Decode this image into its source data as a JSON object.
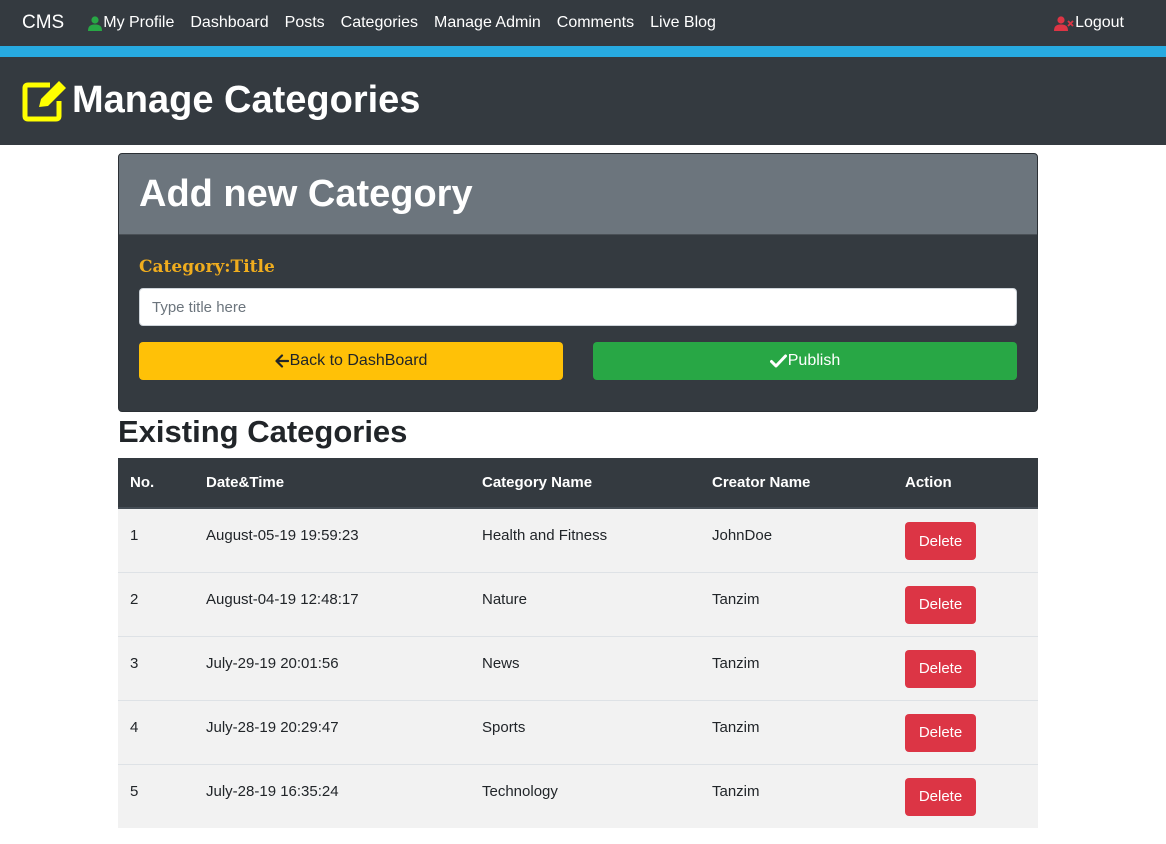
{
  "navbar": {
    "brand": "CMS",
    "links": [
      {
        "label": "My Profile",
        "icon": "user-icon"
      },
      {
        "label": "Dashboard"
      },
      {
        "label": "Posts"
      },
      {
        "label": "Categories"
      },
      {
        "label": "Manage Admin"
      },
      {
        "label": "Comments"
      },
      {
        "label": "Live Blog"
      }
    ],
    "logout": {
      "label": "Logout",
      "icon": "user-times-icon"
    }
  },
  "header": {
    "title": "Manage Categories",
    "icon": "edit-icon"
  },
  "form": {
    "heading": "Add new Category",
    "label": "Category:Title",
    "input_value": "",
    "input_placeholder": "Type title here",
    "back_button": {
      "label": "Back to DashBoard",
      "icon": "arrow-left-icon"
    },
    "publish_button": {
      "label": "Publish",
      "icon": "check-icon"
    }
  },
  "categories": {
    "heading": "Existing Categories",
    "columns": [
      "No.",
      "Date&Time",
      "Category Name",
      "Creator Name",
      "Action"
    ],
    "rows": [
      {
        "no": "1",
        "datetime": "August-05-19 19:59:23",
        "name": "Health and Fitness",
        "creator": "JohnDoe",
        "action": "Delete"
      },
      {
        "no": "2",
        "datetime": "August-04-19 12:48:17",
        "name": "Nature",
        "creator": "Tanzim",
        "action": "Delete"
      },
      {
        "no": "3",
        "datetime": "July-29-19 20:01:56",
        "name": "News",
        "creator": "Tanzim",
        "action": "Delete"
      },
      {
        "no": "4",
        "datetime": "July-28-19 20:29:47",
        "name": "Sports",
        "creator": "Tanzim",
        "action": "Delete"
      },
      {
        "no": "5",
        "datetime": "July-28-19 16:35:24",
        "name": "Technology",
        "creator": "Tanzim",
        "action": "Delete"
      }
    ]
  },
  "colors": {
    "navbar_bg": "#343a40",
    "accent_strip": "#27aae1",
    "card_header_bg": "#6c757d",
    "label_color": "#f0ad1e",
    "back_button": "#ffc107",
    "publish_button": "#28a745",
    "delete_button": "#dc3545",
    "profile_icon": "#28a745",
    "logout_icon": "#dc3545",
    "edit_icon": "#ffff00"
  }
}
